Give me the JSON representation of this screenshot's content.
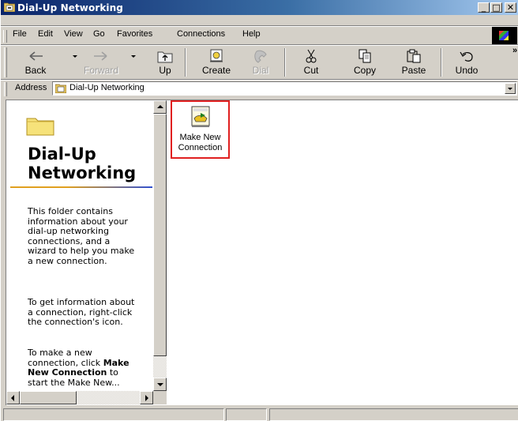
{
  "window": {
    "title": "Dial-Up Networking",
    "controls": {
      "minimize": "_",
      "maximize": "□",
      "close": "✕"
    }
  },
  "menubar": {
    "items": [
      {
        "label": "File"
      },
      {
        "label": "Edit"
      },
      {
        "label": "View"
      },
      {
        "label": "Go"
      },
      {
        "label": "Favorites"
      },
      {
        "label": "Connections"
      },
      {
        "label": "Help"
      }
    ]
  },
  "toolbar": {
    "buttons": [
      {
        "label": "Back",
        "icon": "back-arrow-icon",
        "enabled": true
      },
      {
        "label": "Forward",
        "icon": "forward-arrow-icon",
        "enabled": false
      },
      {
        "label": "Up",
        "icon": "up-folder-icon",
        "enabled": true
      },
      {
        "label": "Create",
        "icon": "create-connection-icon",
        "enabled": true
      },
      {
        "label": "Dial",
        "icon": "dial-icon",
        "enabled": false
      },
      {
        "label": "Cut",
        "icon": "scissors-icon",
        "enabled": true
      },
      {
        "label": "Copy",
        "icon": "copy-icon",
        "enabled": true
      },
      {
        "label": "Paste",
        "icon": "paste-icon",
        "enabled": true
      },
      {
        "label": "Undo",
        "icon": "undo-icon",
        "enabled": true
      }
    ],
    "overflow": "»"
  },
  "addressbar": {
    "label": "Address",
    "value": "Dial-Up Networking"
  },
  "leftpane": {
    "title": "Dial-Up Networking",
    "paragraph1": "This folder contains information about your dial-up networking connections, and a wizard to help you make a new connection.",
    "paragraph2": "To get information about a connection, right-click the connection's icon.",
    "paragraph3_pre": "To make a new connection, click",
    "paragraph3_bold": "Make New Connection",
    "paragraph3_post": "to start the Make New..."
  },
  "items": [
    {
      "label": "Make New Connection",
      "icon": "make-new-connection-icon"
    }
  ],
  "colors": {
    "titlebar_start": "#0a246a",
    "titlebar_end": "#a6caf0",
    "window_face": "#d4d0c8",
    "highlight_box": "#e02020"
  }
}
